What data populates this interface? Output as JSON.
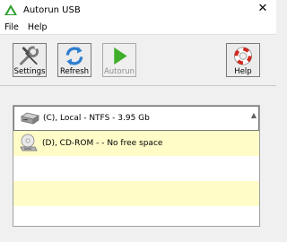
{
  "window": {
    "title": "Autorun USB",
    "close_glyph": "✕"
  },
  "menu": {
    "items": [
      "File",
      "Help"
    ]
  },
  "toolbar": {
    "settings_label": "Settings",
    "refresh_label": "Refresh",
    "autorun_label": "Autorun",
    "help_label": "Help"
  },
  "drives": [
    {
      "text": "(C), Local -  NTFS - 3.95 Gb",
      "icon": "hard-drive-icon"
    },
    {
      "text": "(D), CD-ROM -    - No free space",
      "icon": "cd-rom-icon"
    }
  ],
  "scroll": {
    "up_glyph": "▲"
  },
  "colors": {
    "row_highlight": "#fffcc8",
    "autorun_green": "#3fae2a",
    "help_red": "#d02a1e"
  }
}
